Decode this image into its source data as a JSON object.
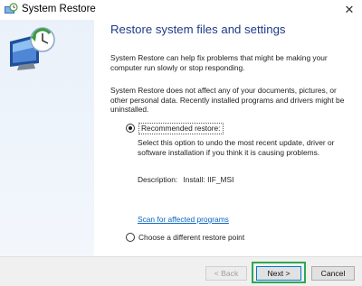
{
  "window": {
    "title": "System Restore",
    "close_glyph": "✕"
  },
  "content": {
    "heading": "Restore system files and settings",
    "para1": "System Restore can help fix problems that might be making your computer run slowly or stop responding.",
    "para2": "System Restore does not affect any of your documents, pictures, or other personal data. Recently installed programs and drivers might be uninstalled.",
    "option_recommended": {
      "label": "Recommended restore:",
      "selected": true,
      "description": "Select this option to undo the most recent update, driver or software installation if you think it is causing problems."
    },
    "description_label": "Description:",
    "description_value": "Install: IIF_MSI",
    "scan_link": "Scan for affected programs",
    "option_different": {
      "label": "Choose a different restore point",
      "selected": false
    }
  },
  "footer": {
    "back_label": "< Back",
    "next_label": "Next >",
    "cancel_label": "Cancel"
  },
  "colors": {
    "heading": "#1e3a8a",
    "link": "#0a66c2",
    "highlight": "#2fa84f",
    "left_panel": "#eaf1fa"
  },
  "icons": {
    "title": "system-restore-icon",
    "hero": "system-restore-clock-monitor-icon"
  }
}
